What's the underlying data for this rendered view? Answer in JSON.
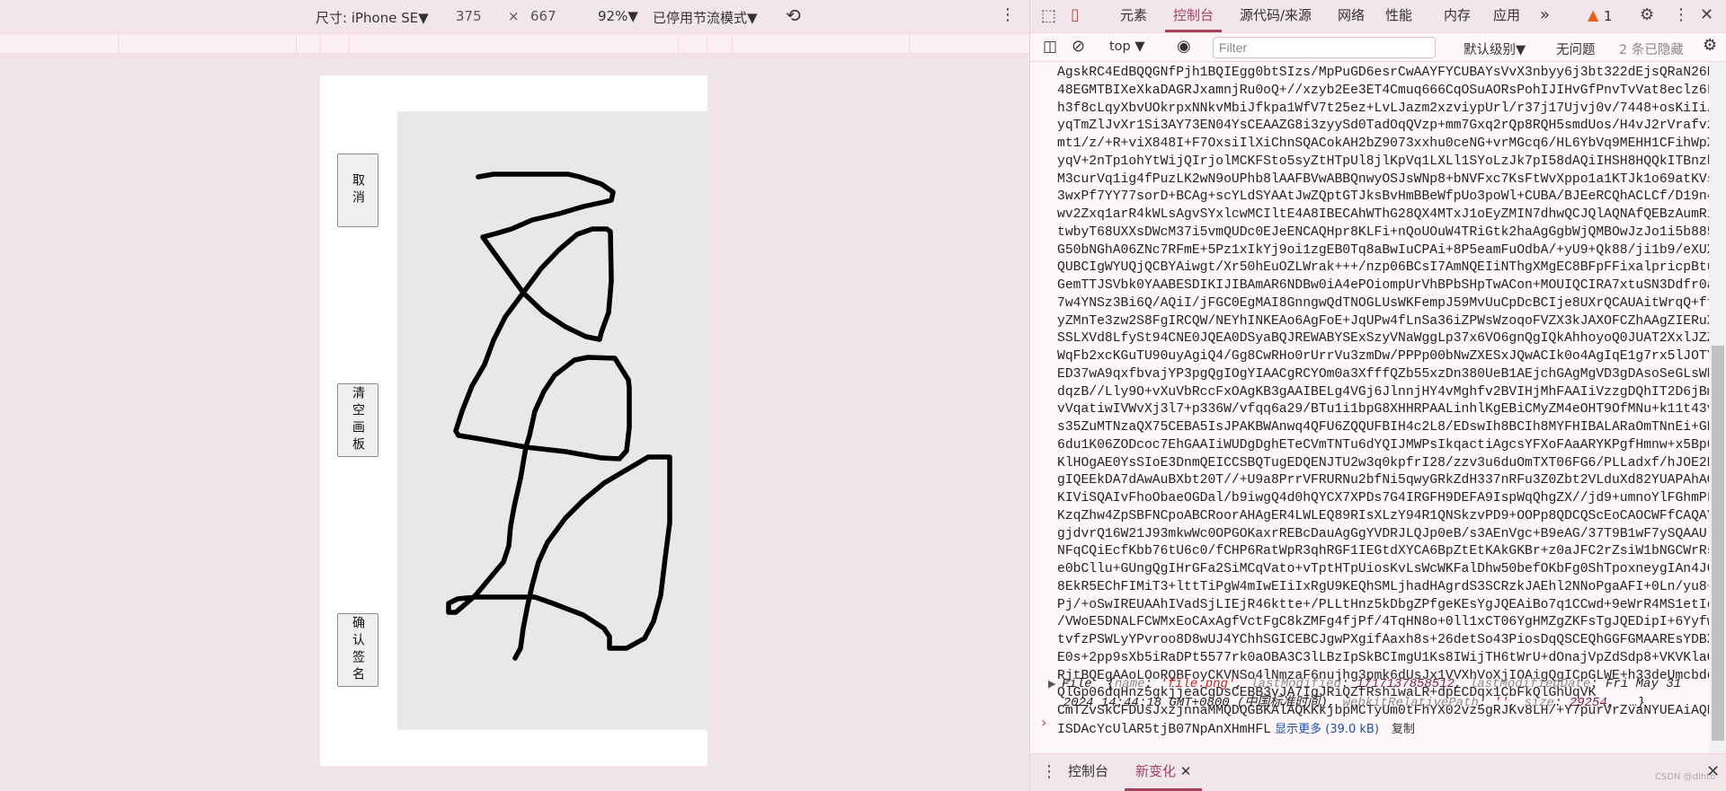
{
  "device_toolbar": {
    "device_label": "尺寸: iPhone SE▼",
    "width": "375",
    "times": "×",
    "height": "667",
    "zoom": "92%▼",
    "throttle": "已停用节流模式▼"
  },
  "page": {
    "buttons": {
      "cancel": "取消",
      "clear": "清空画板",
      "confirm": "确认签名"
    },
    "signature_stroke_color": "#000000",
    "canvas_bg": "#e8e8e8"
  },
  "devtools": {
    "tabs": [
      "元素",
      "控制台",
      "源代码/来源",
      "网络",
      "性能",
      "内存",
      "应用"
    ],
    "active_tab": "控制台",
    "more_tabs": "»",
    "warning_count": "1",
    "context": "top ▼",
    "filter_placeholder": "Filter",
    "level": "默认级别▼",
    "issues": "无问题",
    "hidden": "2 条已隐藏",
    "console_lines": [
      "AgskRC4EdBQQGNfPjh1BQIEgg0btSIzs/MpPuGD6esrCwAAYFYCUBAYsVvX3nbyy6j3bt322dEjsQRaN26NY1",
      "48EGMTBIXeXkaDAGRJxamnjRu0oQ+//xzyb2Ee3ET4Cmuq666CqOSuAORsPohIJIHvGfPnvTvVat8eclz6LzT",
      "h3f8cLqyXbvUOkrpxNNkvMbiJfkpa1WfV7t25ez+LvLJazm2xzviypUrl/r37j17Ujvj0v/7448+osKiIi/oz",
      "yqTmZlJvXr1Si3AY73EN04YsCEAAZG8i3zyySd0TadOqQVzp+mm7Gxq2rQp8RQH5smdUos/H4vJ2rVrafv27a",
      "mt1/z/+R+viX848I+F7OxsiIlXiChnSQACokAH2bZ9073xxhu0ceNG+vrMGcq6/HL6YbVq9MEHH1CFihWpXNm",
      "yqV+2nTp1ohYtWijQIrjolMCKFSto5syZtHTpUl8jlKpVq1LXLl1SYoLzJk7pI58dAQiIHSH8HQQkITBnzhya",
      "M3curVq1ig4fPuzLK2wN9oUPhb8lAAFBVwABBQnwyOSJsWNp8+bNVFxc7KsFtWvXppo1a1KTJk1o69atKVsXX",
      "3wxPf7YY77sorD+BCAg+scYLdSYAAtJwZQptGTJksBvHmBBeWfpUo3poWl+CUBA/BJEeRCQhACLCf/D19n4WX",
      "wv2Zxq1arR4kWLsAgvSYxlcwMCIltE4A8IBECAhWThG28QX4MTxJ1oEyZMIN7dhwQCJQlAQNAfQEBzAumRid+",
      "twbyT68UXXsDWcM37i5vmQUDc0EJeENCAQHpr8KLFi+nQoUOuW4TRiGtk2haAgGgbWjQMBOwJzJo1i5b885+p",
      "G50bNGhA06ZNc7RFmE+5Pz1xIkYj9oi1zgEB0Tq8aBwIuCPAi+8P5eamFuOdbA/+yU9+Qk88/ji1b9/eXUXIr",
      "QUBCIgWYUQjQCBYAiwgt/Xr50hEuOZLWrak+++/nzp06BCsI7AmNQEIiNThgXMgEC8BFpFFixalpricpBtuuI",
      "GemTTJSVbk0YAABESDIKIJIBAmAR6NDBw0iA4ePOiompUrVhBPbSHpTwACon+MOUIQCIRA7xtuSN3Ddfr0aUt",
      "7w4YNSz3Bi6Q/AQiI/jFGC0EgMAI8GnngwQdTNOGLUsWKFempJ59MvUuCpDcBCIje8UXrQCAUAitWrqQ+ffrQ",
      "yZMnTe3zw2S8FgIRCQW/NEYhINKEAo6AgFoE+JqUPw4fLnSa36iZPWsWzoqoFVZX3kJAXOFCZhAAgZIERuXl0",
      "SSLXVd8LfySt94CNE0JQEA0DSyaBQJREWABYSExSzyVNaWggLp37x6VO6gnQgIQkAhhoyoQ0JUAT2XxlJZZat",
      "WqFb2xcKGuTU90uyAgiQ4/Gg8CwRHo0rUrrVu3zmDw/PPPp00bNwZXESxJQwACIk0o4AgIqE1g7rx5lJOTY2j",
      "ED37wA9qxfbvajYP3pgQgIOgYIAACgRCYOm0a3XfffQZb55xzDn380UeB1AEjchGAgMgVD3gDAsoSeGLsWBo7",
      "dqzB//Lly9O+vXuVbRccFxOAgKB3gAAIBELg4VGj6JlnnjHY4vMghfv2BVIHjMhFAAIiVzzgDQhIT2D6jBm0e",
      "vVqatiwIVWvXj3l7+p336W/vfqq6a29/BTu1i1bpG8XHHRPAALinhlKgEBiCMyZM4eOHT9OfMNu+k11t43v3b",
      "s35ZuMTNzaQX75CEBA5IsJPAKBWAnwq4QFU6ZQQUFBIH4c2L8/EDswIh8BCIh8MYFHIBALARaOmTNnEi+GB5W",
      "6du1K06ZODcoc7EhGAAIiWUDgDghETeCVmTNTu6dYQIJMWPsIkqactiAgcsYFXoFAaARYKPgfHmnw+x5Bp0qV",
      "KlHOgAE0YsSIoE3DnmQEICCSBQTugEDQENJTU2w3q0kpfrI28/zzv3u6duOmTXT06FG6/PLLadxf/hJOE2BPU",
      "gIQEEkDA7dAwAuBXbt20T//+U9a8PrrVFRURNu2bfNi5qwyGRkZdH337nRFu3Z0Zbt2VLduXd82YUAPAhAQPe",
      "KIViSQAIvFhoObaeOGDal/b9iwgQ4d0hQYCX7XPDs7G4IRGFH9DEFA9IspWqQhgZX//jd9+umnoYlFGhmPLm7",
      "KzqZhw4ZpSBFNCpoABCRoorAHAgER4LWLEQ89RIsXLzY94R1QNSkzvPD9+OOPp8QDCQScEoCAOCWFfCAQAYH0",
      "gjdvrQ16W21J93mkwWc0OPGOKaxrREBcDauAgGgYVDRJLQJp0eB/s3AEnVgc+B9eAG/37T9B1wF7ySQAAUlm3",
      "NFqCQiEcfKbb76tU6c0/fCHP6RatWpR3qhRGF1IEGtdXYCA6BpZtEtKAkGKBr+z0aJFC2rZsiW1bNGCWrRsZ",
      "e0bCllu+GUngQgIHrGFa2SiMCqVato+vTptHTpUiosKvLsWcWKFalDhw50befOKbFg0ShTpoxneygIAn4JQED",
      "8EkR5EChFIMiT3+lttTiPgW4mIwEIiIxRgU9KEQhSMLjhadHAgrdS3SCRzkJAEhl2NNoPgaAFI+0Ln/yu8+1B",
      "Pj/+oSwIREUAAhIVadSjLIEjR46ktte+/PLLtHnz5kDbgZPfgeKEsYgJQEAiBo7q1CCwd+9eWrR4MS1etIetIgWv",
      "/VWoE5DNALFCWMxEoCAxAgfVctFgC8kZMFg4fjPf/4TqHN8o+0ll1xCT06YgHMZgZKFsTgJQEDipI+6Yyfw9t",
      "tvfzPSWLyYPvroo8D8wUJ4YChhSGICEBCJgwPXgifAaxh8s+26detSo43PiosDqQSCEQhGGFGMAAREsYDBXWc",
      "E0s+2pp9sXb5iRaDPt5577rk0aOBA3C3lLBzIpSkBCImgU1Ks8IWijTH6tWrU+dOnajVpZdSdp8+VKVKlaQg",
      "RjtBQEgAAoLOoRQBFoyCKVNSo4lNmzaF6nujhg3pmk6dUsJx1VVXhVoXjIOAigQgICpGLWE+h33deUmcbdq0S",
      "QlGp06dqHnz5gkjjeaCgDsCEBB3vJA7IgJRiQZfRshiwaLR+dpECDqx1CbFkQlGhUqVK",
      "CmTZvSkCFDUsJxzjnnaMMQDQGBKAlAQKKkjbpMCTyUm0tFhYX02vz5gRJKv8LH/+Y7purVrZvaNYUEAiAQDAE",
      "ISDAcYcUlAR5tjB07NpAnXHmHFL"
    ],
    "show_more": "显示更多 (39.0 kB)",
    "copy": "复制",
    "file_object": {
      "type": "File",
      "name_key": "name",
      "name_val": "'file.png'",
      "lm_key": "lastModified",
      "lm_val": "1717137858512",
      "lmd_key": "lastModifiedDate",
      "lmd_val": "Fri May 31 2024 14:44:18 GMT+0800 (中国标准时间)",
      "wrp_key": "webkitRelativePath",
      "wrp_val": "''",
      "size_key": "size",
      "size_val": "29254",
      "ellipsis": "…"
    },
    "prompt": "›",
    "drawer_tabs": [
      "控制台",
      "新变化"
    ],
    "drawer_active": "新变化",
    "watermark": "CSDN @dlhto",
    "accent": "#a3445e"
  }
}
